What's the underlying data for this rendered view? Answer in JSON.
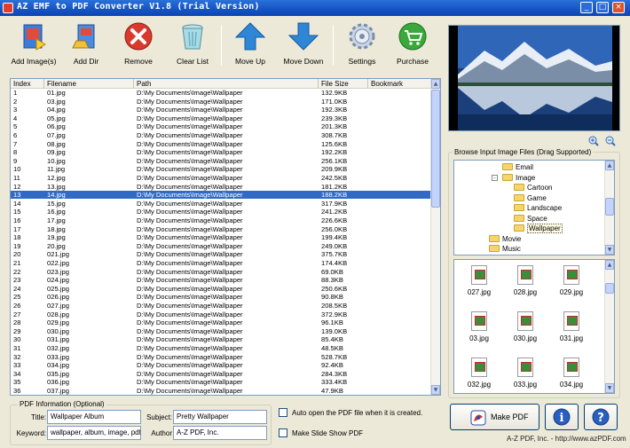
{
  "window": {
    "title": "AZ EMF to PDF Converter V1.8 (Trial Version)",
    "controls": {
      "minimize": "_",
      "maximize": "□",
      "close": "×"
    }
  },
  "toolbar": {
    "add_images": "Add Image(s)",
    "add_dir": "Add Dir",
    "remove": "Remove",
    "clear_list": "Clear List",
    "move_up": "Move Up",
    "move_down": "Move Down",
    "settings": "Settings",
    "purchase": "Purchase"
  },
  "file_list": {
    "columns": [
      "Index",
      "Filename",
      "Path",
      "File Size",
      "Bookmark"
    ],
    "selected_index": 13,
    "rows": [
      {
        "index": "1",
        "filename": "01.jpg",
        "path": "D:\\My Documents\\Image\\Wallpaper",
        "size": "132.9KB"
      },
      {
        "index": "2",
        "filename": "03.jpg",
        "path": "D:\\My Documents\\Image\\Wallpaper",
        "size": "171.0KB"
      },
      {
        "index": "3",
        "filename": "04.jpg",
        "path": "D:\\My Documents\\Image\\Wallpaper",
        "size": "192.3KB"
      },
      {
        "index": "4",
        "filename": "05.jpg",
        "path": "D:\\My Documents\\Image\\Wallpaper",
        "size": "239.3KB"
      },
      {
        "index": "5",
        "filename": "06.jpg",
        "path": "D:\\My Documents\\Image\\Wallpaper",
        "size": "201.3KB"
      },
      {
        "index": "6",
        "filename": "07.jpg",
        "path": "D:\\My Documents\\Image\\Wallpaper",
        "size": "308.7KB"
      },
      {
        "index": "7",
        "filename": "08.jpg",
        "path": "D:\\My Documents\\Image\\Wallpaper",
        "size": "125.6KB"
      },
      {
        "index": "8",
        "filename": "09.jpg",
        "path": "D:\\My Documents\\Image\\Wallpaper",
        "size": "192.2KB"
      },
      {
        "index": "9",
        "filename": "10.jpg",
        "path": "D:\\My Documents\\Image\\Wallpaper",
        "size": "256.1KB"
      },
      {
        "index": "10",
        "filename": "11.jpg",
        "path": "D:\\My Documents\\Image\\Wallpaper",
        "size": "209.9KB"
      },
      {
        "index": "11",
        "filename": "12.jpg",
        "path": "D:\\My Documents\\Image\\Wallpaper",
        "size": "242.5KB"
      },
      {
        "index": "12",
        "filename": "13.jpg",
        "path": "D:\\My Documents\\Image\\Wallpaper",
        "size": "181.2KB"
      },
      {
        "index": "13",
        "filename": "14.jpg",
        "path": "D:\\My Documents\\Image\\Wallpaper",
        "size": "188.2KB"
      },
      {
        "index": "14",
        "filename": "15.jpg",
        "path": "D:\\My Documents\\Image\\Wallpaper",
        "size": "317.9KB"
      },
      {
        "index": "15",
        "filename": "16.jpg",
        "path": "D:\\My Documents\\Image\\Wallpaper",
        "size": "241.2KB"
      },
      {
        "index": "16",
        "filename": "17.jpg",
        "path": "D:\\My Documents\\Image\\Wallpaper",
        "size": "226.6KB"
      },
      {
        "index": "17",
        "filename": "18.jpg",
        "path": "D:\\My Documents\\Image\\Wallpaper",
        "size": "256.0KB"
      },
      {
        "index": "18",
        "filename": "19.jpg",
        "path": "D:\\My Documents\\Image\\Wallpaper",
        "size": "199.4KB"
      },
      {
        "index": "19",
        "filename": "20.jpg",
        "path": "D:\\My Documents\\Image\\Wallpaper",
        "size": "249.0KB"
      },
      {
        "index": "20",
        "filename": "021.jpg",
        "path": "D:\\My Documents\\Image\\Wallpaper",
        "size": "375.7KB"
      },
      {
        "index": "21",
        "filename": "022.jpg",
        "path": "D:\\My Documents\\Image\\Wallpaper",
        "size": "174.4KB"
      },
      {
        "index": "22",
        "filename": "023.jpg",
        "path": "D:\\My Documents\\Image\\Wallpaper",
        "size": "69.0KB"
      },
      {
        "index": "23",
        "filename": "024.jpg",
        "path": "D:\\My Documents\\Image\\Wallpaper",
        "size": "88.3KB"
      },
      {
        "index": "24",
        "filename": "025.jpg",
        "path": "D:\\My Documents\\Image\\Wallpaper",
        "size": "250.6KB"
      },
      {
        "index": "25",
        "filename": "026.jpg",
        "path": "D:\\My Documents\\Image\\Wallpaper",
        "size": "90.8KB"
      },
      {
        "index": "26",
        "filename": "027.jpg",
        "path": "D:\\My Documents\\Image\\Wallpaper",
        "size": "208.5KB"
      },
      {
        "index": "27",
        "filename": "028.jpg",
        "path": "D:\\My Documents\\Image\\Wallpaper",
        "size": "372.9KB"
      },
      {
        "index": "28",
        "filename": "029.jpg",
        "path": "D:\\My Documents\\Image\\Wallpaper",
        "size": "96.1KB"
      },
      {
        "index": "29",
        "filename": "030.jpg",
        "path": "D:\\My Documents\\Image\\Wallpaper",
        "size": "139.0KB"
      },
      {
        "index": "30",
        "filename": "031.jpg",
        "path": "D:\\My Documents\\Image\\Wallpaper",
        "size": "85.4KB"
      },
      {
        "index": "31",
        "filename": "032.jpg",
        "path": "D:\\My Documents\\Image\\Wallpaper",
        "size": "48.5KB"
      },
      {
        "index": "32",
        "filename": "033.jpg",
        "path": "D:\\My Documents\\Image\\Wallpaper",
        "size": "528.7KB"
      },
      {
        "index": "33",
        "filename": "034.jpg",
        "path": "D:\\My Documents\\Image\\Wallpaper",
        "size": "92.4KB"
      },
      {
        "index": "34",
        "filename": "035.jpg",
        "path": "D:\\My Documents\\Image\\Wallpaper",
        "size": "284.3KB"
      },
      {
        "index": "35",
        "filename": "036.jpg",
        "path": "D:\\My Documents\\Image\\Wallpaper",
        "size": "333.4KB"
      },
      {
        "index": "36",
        "filename": "037.jpg",
        "path": "D:\\My Documents\\Image\\Wallpaper",
        "size": "47.9KB"
      }
    ]
  },
  "browser": {
    "label": "Browse Input Image Files (Drag Supported)",
    "tree": [
      {
        "name": "Email",
        "level": 0,
        "expander": ""
      },
      {
        "name": "Image",
        "level": 0,
        "expander": "-"
      },
      {
        "name": "Cartoon",
        "level": 1,
        "expander": ""
      },
      {
        "name": "Game",
        "level": 1,
        "expander": ""
      },
      {
        "name": "Landscape",
        "level": 1,
        "expander": ""
      },
      {
        "name": "Space",
        "level": 1,
        "expander": ""
      },
      {
        "name": "Wallpaper",
        "level": 1,
        "expander": ""
      },
      {
        "name": "Movie",
        "level": -1,
        "expander": ""
      },
      {
        "name": "Music",
        "level": -1,
        "expander": ""
      }
    ],
    "selected_folder": "Wallpaper",
    "thumbnails": [
      "027.jpg",
      "028.jpg",
      "029.jpg",
      "03.jpg",
      "030.jpg",
      "031.jpg",
      "032.jpg",
      "033.jpg",
      "034.jpg"
    ]
  },
  "pdf_info": {
    "label": "PDF Information (Optional)",
    "title_label": "Title:",
    "title_value": "Wallpaper Album",
    "subject_label": "Subject:",
    "subject_value": "Pretty Wallpaper",
    "keyword_label": "Keyword:",
    "keyword_value": "wallpaper, album, image, pdf",
    "author_label": "Author",
    "author_value": "A-Z PDF, Inc."
  },
  "options": {
    "auto_open": "Auto open the PDF file when it is created.",
    "slide_show": "Make Slide Show PDF"
  },
  "actions": {
    "make_pdf": "Make PDF",
    "info": "i",
    "help": "?"
  },
  "footer": "A-Z PDF, Inc. - http://www.azPDF.com",
  "colors": {
    "selection": "#316ac5",
    "titlebar": "#1553c4",
    "remove_red": "#d93a2e",
    "arrow_blue": "#2f86d6",
    "purchase_green": "#3aa83a"
  }
}
